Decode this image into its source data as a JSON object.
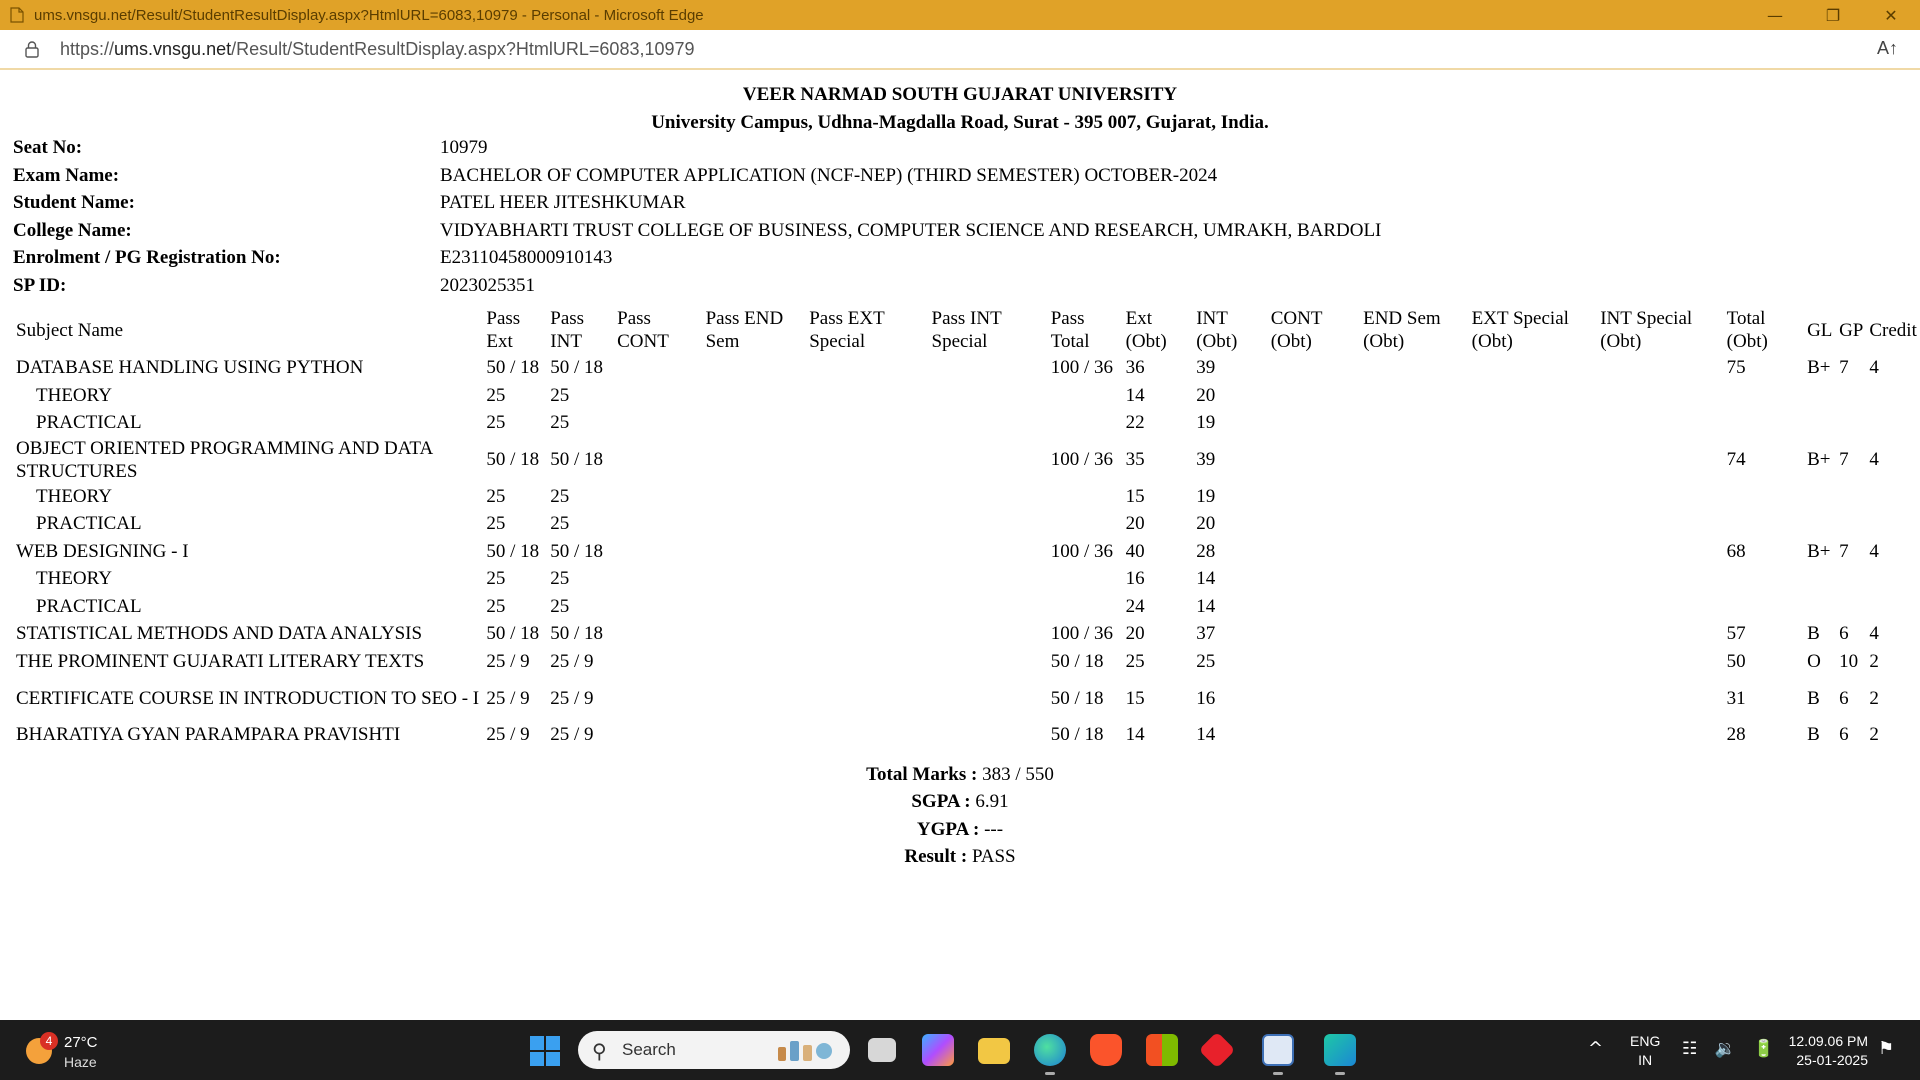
{
  "window": {
    "title": "ums.vnsgu.net/Result/StudentResultDisplay.aspx?HtmlURL=6083,10979 - Personal - Microsoft Edge",
    "minimize": "—",
    "restore": "❐",
    "close": "✕"
  },
  "address": {
    "prefix": "https://",
    "host": "ums.vnsgu.net",
    "path": "/Result/StudentResultDisplay.aspx?HtmlURL=6083,10979",
    "read_aloud": "A↑"
  },
  "header": {
    "university": "VEER NARMAD SOUTH GUJARAT UNIVERSITY",
    "address": "University Campus, Udhna-Magdalla Road, Surat - 395 007, Gujarat, India."
  },
  "info": [
    {
      "label": "Seat No:",
      "value": "10979"
    },
    {
      "label": "Exam Name:",
      "value": "BACHELOR OF COMPUTER APPLICATION (NCF-NEP) (THIRD SEMESTER) OCTOBER-2024"
    },
    {
      "label": "Student Name:",
      "value": "PATEL HEER JITESHKUMAR"
    },
    {
      "label": "College Name:",
      "value": "VIDYABHARTI TRUST COLLEGE OF BUSINESS, COMPUTER SCIENCE AND RESEARCH, UMRAKH, BARDOLI"
    },
    {
      "label": "Enrolment / PG Registration No:",
      "value": "E23110458000910143"
    },
    {
      "label": "SP ID:",
      "value": "2023025351"
    }
  ],
  "table": {
    "headers": [
      [
        "Subject Name",
        ""
      ],
      [
        "Pass",
        "Ext"
      ],
      [
        "Pass",
        "INT"
      ],
      [
        "Pass",
        "CONT"
      ],
      [
        "Pass END",
        "Sem"
      ],
      [
        "Pass EXT",
        "Special"
      ],
      [
        "Pass INT",
        "Special"
      ],
      [
        "Pass",
        "Total"
      ],
      [
        "Ext",
        "(Obt)"
      ],
      [
        "INT",
        "(Obt)"
      ],
      [
        "CONT",
        "(Obt)"
      ],
      [
        "END Sem",
        "(Obt)"
      ],
      [
        "EXT Special",
        "(Obt)"
      ],
      [
        "INT Special",
        "(Obt)"
      ],
      [
        "Total",
        "(Obt)"
      ],
      [
        "GL",
        ""
      ],
      [
        "GP",
        ""
      ],
      [
        "Credit",
        ""
      ]
    ],
    "rows": [
      {
        "indent": false,
        "tall": false,
        "cells": [
          "DATABASE HANDLING USING PYTHON",
          "50 / 18",
          "50 / 18",
          "",
          "",
          "",
          "",
          "100 / 36",
          "36",
          "39",
          "",
          "",
          "",
          "",
          "75",
          "B+",
          "7",
          "4"
        ]
      },
      {
        "indent": true,
        "tall": false,
        "cells": [
          "THEORY",
          "25",
          "25",
          "",
          "",
          "",
          "",
          "",
          "14",
          "20",
          "",
          "",
          "",
          "",
          "",
          "",
          "",
          ""
        ]
      },
      {
        "indent": true,
        "tall": false,
        "cells": [
          "PRACTICAL",
          "25",
          "25",
          "",
          "",
          "",
          "",
          "",
          "22",
          "19",
          "",
          "",
          "",
          "",
          "",
          "",
          "",
          ""
        ]
      },
      {
        "indent": false,
        "tall": true,
        "cells": [
          "OBJECT ORIENTED PROGRAMMING AND DATA STRUCTURES",
          "50 / 18",
          "50 / 18",
          "",
          "",
          "",
          "",
          "100 / 36",
          "35",
          "39",
          "",
          "",
          "",
          "",
          "74",
          "B+",
          "7",
          "4"
        ]
      },
      {
        "indent": true,
        "tall": false,
        "cells": [
          "THEORY",
          "25",
          "25",
          "",
          "",
          "",
          "",
          "",
          "15",
          "19",
          "",
          "",
          "",
          "",
          "",
          "",
          "",
          ""
        ]
      },
      {
        "indent": true,
        "tall": false,
        "cells": [
          "PRACTICAL",
          "25",
          "25",
          "",
          "",
          "",
          "",
          "",
          "20",
          "20",
          "",
          "",
          "",
          "",
          "",
          "",
          "",
          ""
        ]
      },
      {
        "indent": false,
        "tall": false,
        "cells": [
          "WEB DESIGNING - I",
          "50 / 18",
          "50 / 18",
          "",
          "",
          "",
          "",
          "100 / 36",
          "40",
          "28",
          "",
          "",
          "",
          "",
          "68",
          "B+",
          "7",
          "4"
        ]
      },
      {
        "indent": true,
        "tall": false,
        "cells": [
          "THEORY",
          "25",
          "25",
          "",
          "",
          "",
          "",
          "",
          "16",
          "14",
          "",
          "",
          "",
          "",
          "",
          "",
          "",
          ""
        ]
      },
      {
        "indent": true,
        "tall": false,
        "cells": [
          "PRACTICAL",
          "25",
          "25",
          "",
          "",
          "",
          "",
          "",
          "24",
          "14",
          "",
          "",
          "",
          "",
          "",
          "",
          "",
          ""
        ]
      },
      {
        "indent": false,
        "tall": false,
        "cells": [
          "STATISTICAL METHODS AND DATA ANALYSIS",
          "50 / 18",
          "50 / 18",
          "",
          "",
          "",
          "",
          "100 / 36",
          "20",
          "37",
          "",
          "",
          "",
          "",
          "57",
          "B",
          "6",
          "4"
        ]
      },
      {
        "indent": false,
        "tall": false,
        "cells": [
          "THE PROMINENT GUJARATI LITERARY TEXTS",
          "25 / 9",
          "25 / 9",
          "",
          "",
          "",
          "",
          "50 / 18",
          "25",
          "25",
          "",
          "",
          "",
          "",
          "50",
          "O",
          "10",
          "2"
        ]
      },
      {
        "indent": false,
        "tall": true,
        "cells": [
          "CERTIFICATE COURSE IN INTRODUCTION TO SEO - I",
          "25 / 9",
          "25 / 9",
          "",
          "",
          "",
          "",
          "50 / 18",
          "15",
          "16",
          "",
          "",
          "",
          "",
          "31",
          "B",
          "6",
          "2"
        ]
      },
      {
        "indent": false,
        "tall": false,
        "cells": [
          "BHARATIYA GYAN PARAMPARA PRAVISHTI",
          "25 / 9",
          "25 / 9",
          "",
          "",
          "",
          "",
          "50 / 18",
          "14",
          "14",
          "",
          "",
          "",
          "",
          "28",
          "B",
          "6",
          "2"
        ]
      }
    ]
  },
  "summary": {
    "total_label": "Total Marks :",
    "total_value": "383 / 550",
    "sgpa_label": "SGPA :",
    "sgpa_value": "6.91",
    "ygpa_label": "YGPA :",
    "ygpa_value": "---",
    "result_label": "Result :",
    "result_value": "PASS"
  },
  "taskbar": {
    "weather_temp": "27°C",
    "weather_desc": "Haze",
    "weather_badge": "4",
    "search_placeholder": "Search",
    "lang_line1": "ENG",
    "lang_line2": "IN",
    "time": "12.09.06 PM",
    "date": "25-01-2025",
    "chevron": "^",
    "tray_icons": "☷ 🔉 🔋",
    "notif_icon": "⚑"
  },
  "colors": {
    "titlebar": "#e0a228",
    "taskbar": "#1c1c1c"
  }
}
